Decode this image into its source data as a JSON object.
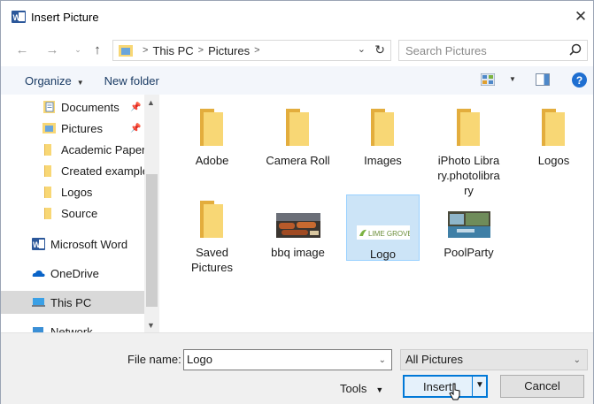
{
  "window": {
    "title": "Insert Picture",
    "close_glyph": "✕"
  },
  "address": {
    "crumbs": [
      "This PC",
      "Pictures"
    ],
    "search_placeholder": "Search Pictures"
  },
  "toolbar": {
    "organize_label": "Organize",
    "new_folder_label": "New folder",
    "help_label": "?"
  },
  "sidebar": {
    "items": [
      {
        "label": "Documents",
        "icon": "documents-icon",
        "pinned": true
      },
      {
        "label": "Pictures",
        "icon": "pictures-folder-icon",
        "pinned": true
      },
      {
        "label": "Academic Paper",
        "icon": "folder-icon"
      },
      {
        "label": "Created example",
        "icon": "folder-icon"
      },
      {
        "label": "Logos",
        "icon": "folder-icon"
      },
      {
        "label": "Source",
        "icon": "folder-icon"
      },
      {
        "label": "Microsoft Word",
        "icon": "word-icon"
      },
      {
        "label": "OneDrive",
        "icon": "onedrive-icon"
      },
      {
        "label": "This PC",
        "icon": "this-pc-icon",
        "selected": true
      },
      {
        "label": "Network",
        "icon": "network-icon"
      }
    ]
  },
  "files": [
    {
      "label": "Adobe",
      "kind": "folder"
    },
    {
      "label": "Camera Roll",
      "kind": "folder"
    },
    {
      "label": "Images",
      "kind": "folder"
    },
    {
      "label": "iPhoto Library.photolibrary",
      "kind": "folder"
    },
    {
      "label": "Logos",
      "kind": "folder"
    },
    {
      "label": "Saved Pictures",
      "kind": "folder"
    },
    {
      "label": "bbq image",
      "kind": "image"
    },
    {
      "label": "Logo",
      "kind": "image",
      "selected": true,
      "logo_text": "LIME GROVE"
    },
    {
      "label": "PoolParty",
      "kind": "image"
    }
  ],
  "footer": {
    "file_name_label": "File name:",
    "file_name_value": "Logo",
    "file_type": "All Pictures",
    "tools_label": "Tools",
    "insert_label": "Insert",
    "cancel_label": "Cancel"
  },
  "colors": {
    "accent": "#0078d7",
    "folder": "#f8d775",
    "selection": "#cce4f7"
  }
}
